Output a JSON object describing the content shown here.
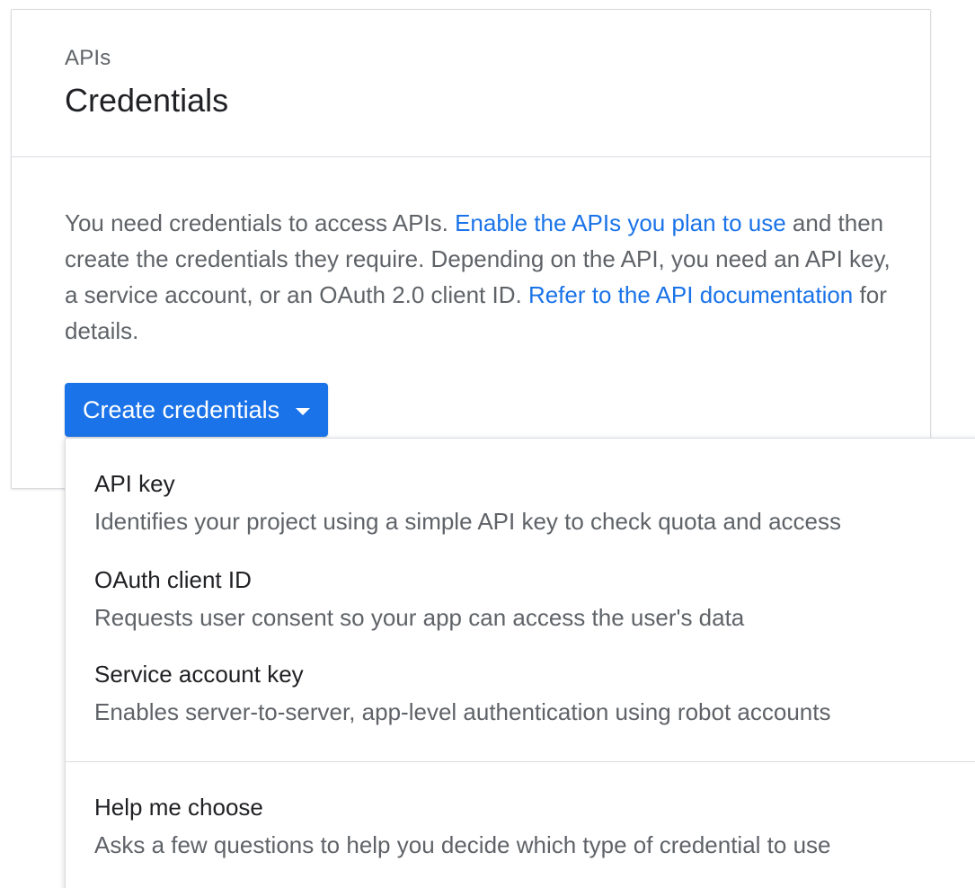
{
  "header": {
    "breadcrumb": "APIs",
    "title": "Credentials"
  },
  "description": {
    "part1": "You need credentials to access APIs. ",
    "link1": "Enable the APIs you plan to use",
    "part2": " and then create the credentials they require. Depending on the API, you need an API key, a service account, or an OAuth 2.0 client ID. ",
    "link2": "Refer to the API documentation",
    "part3": " for details."
  },
  "create_button": {
    "label": "Create credentials",
    "icon": "caret-down-icon"
  },
  "menu": {
    "items": [
      {
        "title": "API key",
        "description": "Identifies your project using a simple API key to check quota and access"
      },
      {
        "title": "OAuth client ID",
        "description": "Requests user consent so your app can access the user's data"
      },
      {
        "title": "Service account key",
        "description": "Enables server-to-server, app-level authentication using robot accounts"
      },
      {
        "title": "Help me choose",
        "description": "Asks a few questions to help you decide which type of credential to use"
      }
    ]
  },
  "colors": {
    "primary": "#1a73e8",
    "text": "#202124",
    "secondary_text": "#5f6368",
    "border": "#dadce0"
  }
}
